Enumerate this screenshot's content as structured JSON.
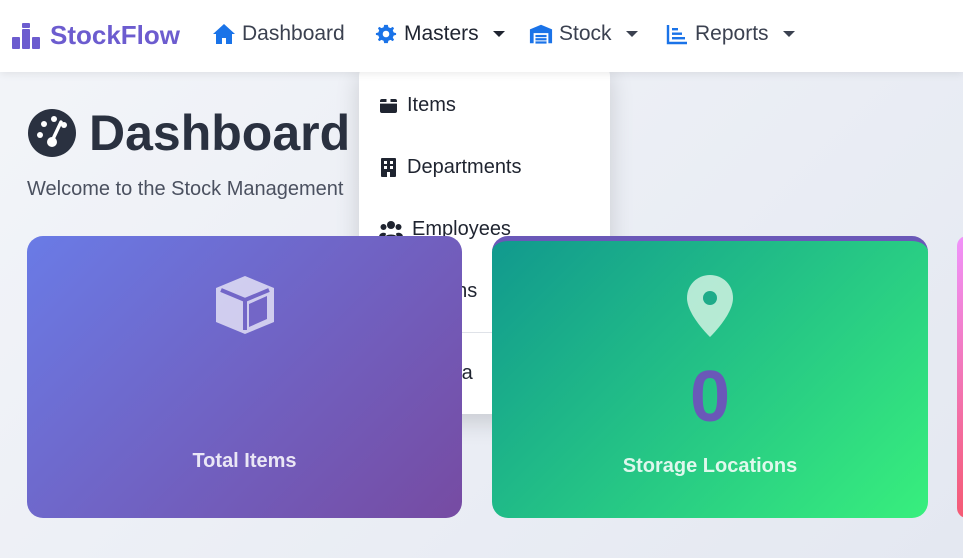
{
  "brand": {
    "name": "StockFlow"
  },
  "nav": {
    "dashboard": "Dashboard",
    "masters": "Masters",
    "stock": "Stock",
    "reports": "Reports"
  },
  "masters_menu": {
    "items": [
      "Items",
      "Departments",
      "Employees",
      "Storage Locations",
      "Item Master"
    ],
    "visible_text": [
      "Items",
      "Departments",
      "Employees",
      "ons",
      "Ma"
    ]
  },
  "header": {
    "title": "Dashboard",
    "welcome": "Welcome to the Stock Management"
  },
  "cards": {
    "items": {
      "value": "",
      "label": "Total Items"
    },
    "storage": {
      "value": "0",
      "label": "Storage Locations"
    }
  },
  "colors": {
    "brand": "#6c5ccf",
    "nav_icon": "#1a73e8",
    "card_items": [
      "#6a7be6",
      "#764ba2"
    ],
    "card_storage": [
      "#11998e",
      "#38ef7d"
    ],
    "value_purple": "#6a58b8"
  },
  "icons": {
    "brand": "boxes-icon",
    "dashboard": "home-icon",
    "masters": "gear-icon",
    "stock": "warehouse-icon",
    "reports": "chart-line-icon",
    "title": "tachometer-icon",
    "items_card": "cube-icon",
    "storage_card": "map-pin-icon"
  }
}
